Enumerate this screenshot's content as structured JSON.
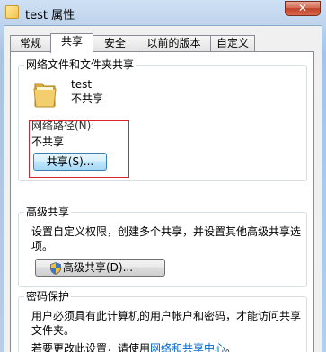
{
  "window": {
    "title": "test 属性",
    "close_symbol": "✕"
  },
  "tabs": [
    {
      "label": "常规",
      "active": false
    },
    {
      "label": "共享",
      "active": true
    },
    {
      "label": "安全",
      "active": false
    },
    {
      "label": "以前的版本",
      "active": false
    },
    {
      "label": "自定义",
      "active": false
    }
  ],
  "network_sharing": {
    "group_title": "网络文件和文件夹共享",
    "folder_name": "test",
    "folder_status": "不共享",
    "path_label": "网络路径(N):",
    "path_value": "不共享",
    "share_button": "共享(S)..."
  },
  "advanced_sharing": {
    "group_title": "高级共享",
    "description_line1": "设置自定义权限，创建多个共享，并设置其他高级共享选",
    "description_line2": "项。",
    "button": "高级共享(D)..."
  },
  "password_protection": {
    "group_title": "密码保护",
    "line1": "用户必须具有此计算机的用户帐户和密码，才能访问共享",
    "line2": "文件夹。",
    "change_prefix": "若要更改此设置，请使用",
    "link_text": "网络和共享中心",
    "change_suffix": "。"
  },
  "icons": {
    "folder": "folder-icon",
    "shield": "uac-shield-icon",
    "window": "folder-icon"
  }
}
